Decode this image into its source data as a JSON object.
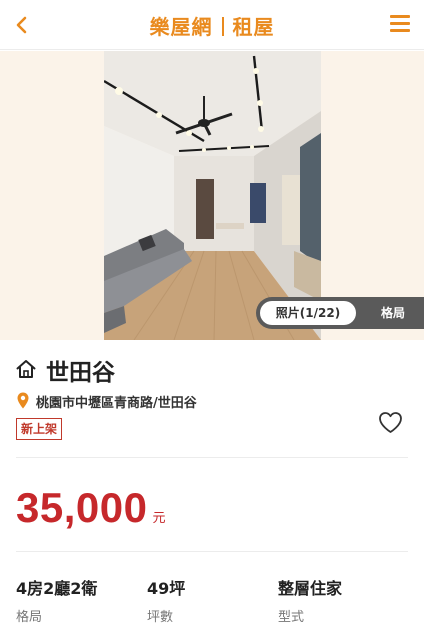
{
  "header": {
    "back_icon": "chevron-left-icon",
    "brand_main": "樂屋網",
    "brand_sub": "租屋",
    "menu_icon": "hamburger-menu-icon",
    "accent_color": "#e98a1e"
  },
  "gallery": {
    "photo_tab_label": "照片(1/22)",
    "layout_tab_label": "格局",
    "current_photo": 1,
    "total_photos": 22
  },
  "listing": {
    "title": "世田谷",
    "title_icon": "house-icon",
    "address": "桃園市中壢區青商路/世田谷",
    "address_icon": "location-pin-icon",
    "badge": "新上架",
    "favorite_icon": "heart-outline-icon",
    "price": "35,000",
    "price_unit": "元",
    "price_color": "#c6282b"
  },
  "specs": [
    {
      "value": "4房2廳2衛",
      "label": "格局"
    },
    {
      "value": "49坪",
      "label": "坪數"
    },
    {
      "value": "整層住家",
      "label": "型式"
    }
  ]
}
